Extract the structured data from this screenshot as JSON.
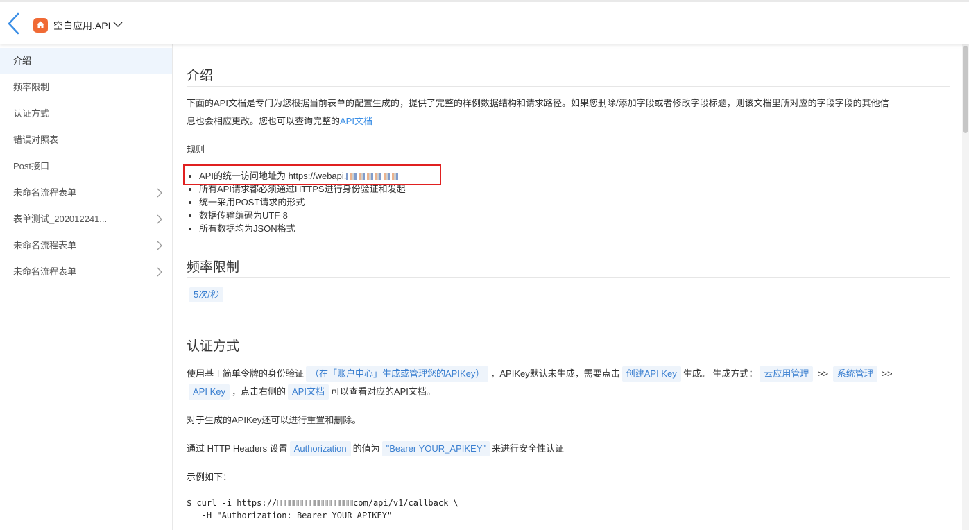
{
  "header": {
    "app_title": "空白应用.API",
    "back_icon": "chevron-left-icon",
    "app_icon": "home-icon",
    "caret_icon": "chevron-down-icon"
  },
  "sidebar": {
    "items": [
      {
        "label": "介绍",
        "active": true
      },
      {
        "label": "频率限制"
      },
      {
        "label": "认证方式"
      },
      {
        "label": "错误对照表"
      },
      {
        "label": "Post接口"
      },
      {
        "label": "未命名流程表单",
        "expandable": true
      },
      {
        "label": "表单测试_202012241...",
        "expandable": true
      },
      {
        "label": "未命名流程表单",
        "expandable": true
      },
      {
        "label": "未命名流程表单",
        "expandable": true
      }
    ]
  },
  "intro": {
    "title": "介绍",
    "desc_part1": "下面的API文档是专门为您根据当前表单的配置生成的，提供了完整的样例数据结构和请求路径。如果您删除/添加字段或者修改字段标题，则该文档里所对应的字段字段的其他信",
    "desc_part2": "息也会相应更改。您也可以查询完整的",
    "desc_link": "API文档",
    "rules_label": "规则",
    "rules": [
      "API的统一访问地址为 https://webapi.",
      "所有API请求都必须通过HTTPS进行身份验证和发起",
      "统一采用POST请求的形式",
      "数据传输编码为UTF-8",
      "所有数据均为JSON格式"
    ]
  },
  "rate": {
    "title": "频率限制",
    "value": "5次/秒"
  },
  "auth": {
    "title": "认证方式",
    "p1_a": "使用基于简单令牌的身份验证",
    "p1_code1": "（在「账户中心」生成或管理您的APIKey）",
    "p1_b": "，APIKey默认未生成，需要点击",
    "p1_code2": "创建API Key",
    "p1_c": "生成。 生成方式：",
    "p1_code3": "云应用管理",
    "p1_sep": ">>",
    "p1_code4": "系统管理",
    "p1_code5": "API Key",
    "p1_d": "，点击右侧的",
    "p1_code6": "API文档",
    "p1_e": "可以查看对应的API文档。",
    "p2": "对于生成的APIKey还可以进行重置和删除。",
    "p3_a": "通过 HTTP Headers 设置",
    "p3_code1": "Authorization",
    "p3_b": "的值为",
    "p3_code2": "\"Bearer YOUR_APIKEY\"",
    "p3_c": "来进行安全性认证",
    "p4": "示例如下：",
    "code_line1_a": "$ curl -i https://",
    "code_line1_b": "com/api/v1/callback \\",
    "code_line2": "   -H \"Authorization: Bearer YOUR_APIKEY\""
  }
}
